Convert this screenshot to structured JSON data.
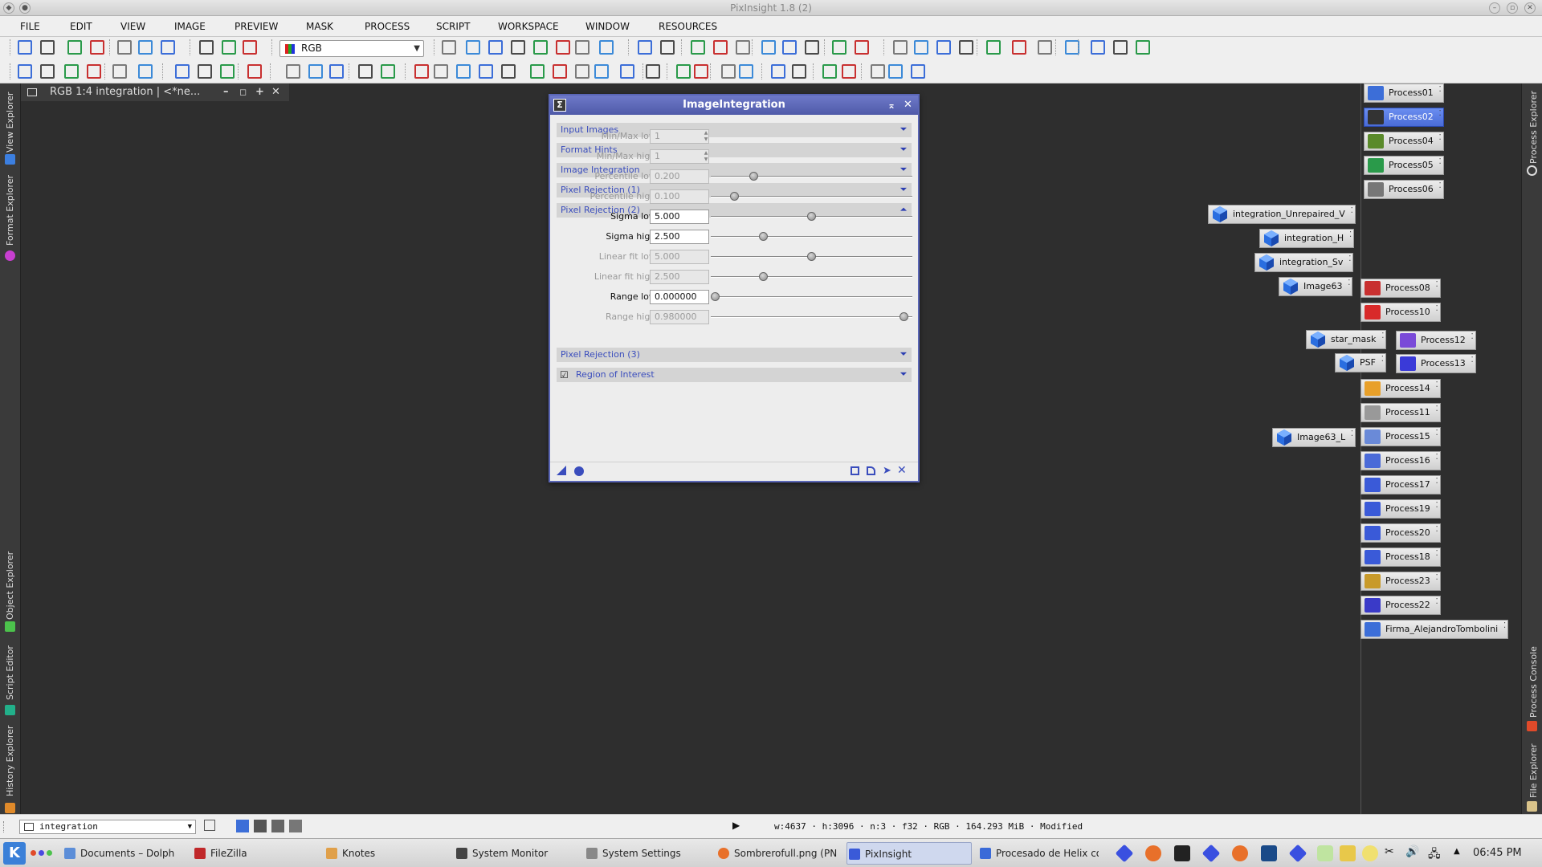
{
  "window": {
    "title": "PixInsight 1.8 (2)"
  },
  "menu": [
    "FILE",
    "EDIT",
    "VIEW",
    "IMAGE",
    "PREVIEW",
    "MASK",
    "PROCESS",
    "SCRIPT",
    "WORKSPACE",
    "WINDOW",
    "RESOURCES"
  ],
  "toolbar": {
    "color_space": "RGB"
  },
  "image_window": {
    "title": "RGB 1:4 integration | <*ne..."
  },
  "left_dock_tabs": [
    "View Explorer",
    "Format Explorer",
    "Object Explorer",
    "Script Editor",
    "History Explorer"
  ],
  "right_dock_tabs": [
    "Process Explorer",
    "Process Console",
    "File Explorer"
  ],
  "dialog": {
    "title": "ImageIntegration",
    "sections_top": [
      "Input Images",
      "Format Hints",
      "Image Integration",
      "Pixel Rejection (1)",
      "Pixel Rejection (2)"
    ],
    "rows": [
      {
        "label": "Min/Max low:",
        "value": "1",
        "enabled": false,
        "spin": true
      },
      {
        "label": "Min/Max high:",
        "value": "1",
        "enabled": false,
        "spin": true
      },
      {
        "label": "Percentile low:",
        "value": "0.200",
        "enabled": false,
        "slider": 0.2
      },
      {
        "label": "Percentile high:",
        "value": "0.100",
        "enabled": false,
        "slider": 0.1
      },
      {
        "label": "Sigma low:",
        "value": "5.000",
        "enabled": true,
        "slider": 0.5
      },
      {
        "label": "Sigma high:",
        "value": "2.500",
        "enabled": true,
        "slider": 0.25
      },
      {
        "label": "Linear fit low:",
        "value": "5.000",
        "enabled": false,
        "slider": 0.5
      },
      {
        "label": "Linear fit high:",
        "value": "2.500",
        "enabled": false,
        "slider": 0.25
      },
      {
        "label": "Range low:",
        "value": "0.000000",
        "enabled": true,
        "slider": 0.0
      },
      {
        "label": "Range high:",
        "value": "0.980000",
        "enabled": false,
        "slider": 0.98
      }
    ],
    "sections_bottom": [
      "Pixel Rejection (3)",
      "Region of Interest"
    ],
    "roi_checked": true
  },
  "process_icons": [
    "Process01",
    "Process02",
    "Process04",
    "Process05",
    "Process06",
    "Process08",
    "Process10",
    "Process12",
    "Process13",
    "Process14",
    "Process11",
    "Process15",
    "Process16",
    "Process17",
    "Process19",
    "Process20",
    "Process18",
    "Process23",
    "Process22",
    "Firma_AlejandroTombolini"
  ],
  "image_icons": [
    "integration_Unrepaired_V",
    "integration_H",
    "integration_Sv",
    "Image63",
    "star_mask",
    "PSF",
    "Image63_L"
  ],
  "status": {
    "view": "integration",
    "info": "w:4637 · h:3096 · n:3 · f32 · RGB · 164.293 MiB · Modified"
  },
  "taskbar": {
    "tasks": [
      "Documents – Dolphin",
      "FileZilla",
      "Knotes",
      "System Monitor",
      "System Settings",
      "Sombrerofull.png (PN",
      "PixInsight",
      "Procesado de Helix co"
    ],
    "clock": "06:45 PM"
  },
  "colors": {
    "dialog_accent": "#5a66b6",
    "section_text": "#3a4dbd",
    "workspace": "#2e2e2e",
    "selected": "#4a6cd8"
  }
}
